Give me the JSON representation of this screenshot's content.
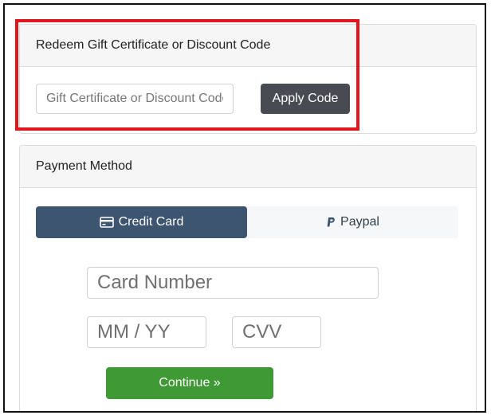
{
  "redeem": {
    "title": "Redeem Gift Certificate or Discount Code",
    "code_placeholder": "Gift Certificate or Discount Code",
    "code_value": "",
    "apply_label": "Apply Code"
  },
  "payment": {
    "title": "Payment Method",
    "tabs": [
      {
        "label": "Credit Card",
        "icon": "credit-card-icon",
        "active": true
      },
      {
        "label": "Paypal",
        "icon": "paypal-icon",
        "active": false
      }
    ],
    "card_number_placeholder": "Card Number",
    "expiry_placeholder": "MM / YY",
    "cvv_placeholder": "CVV",
    "continue_label": "Continue »"
  },
  "colors": {
    "highlight": "#e0161e",
    "active_tab": "#3d5570",
    "apply_button": "#474c53",
    "continue_button": "#3f9a36"
  }
}
